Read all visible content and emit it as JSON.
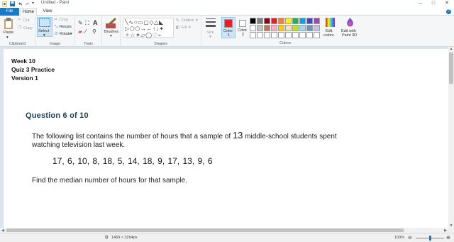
{
  "window": {
    "title": "Untitled - Paint",
    "controls": [
      "–",
      "□",
      "✕"
    ]
  },
  "tabs": {
    "file": "File",
    "home": "Home",
    "view": "View"
  },
  "ribbon": {
    "clipboard": {
      "paste": "Paste",
      "cut": "Cut",
      "copy": "Copy",
      "label": "Clipboard"
    },
    "image": {
      "select": "Select",
      "crop": "Crop",
      "resize": "Resize",
      "rotate": "Rotate",
      "label": "Image"
    },
    "tools": {
      "label": "Tools"
    },
    "brushes": {
      "label": "Brushes"
    },
    "shapes": {
      "outline": "Outline",
      "fill": "Fill",
      "label": "Shapes"
    },
    "size": {
      "label": "Size"
    },
    "color1": {
      "label": "Color",
      "num": "1",
      "value": "#ed1c24"
    },
    "color2": {
      "label": "Color",
      "num": "2",
      "value": "#ffffff"
    },
    "colors": {
      "label": "Colors",
      "palette_row1": [
        "#000000",
        "#7f7f7f",
        "#880015",
        "#ed1c24",
        "#ff7f27",
        "#fff200",
        "#22b14c",
        "#00a2e8",
        "#3f48cc",
        "#a349a4"
      ],
      "palette_row2": [
        "#ffffff",
        "#c3c3c3",
        "#b97a57",
        "#ffaec9",
        "#ffc90e",
        "#efe4b0",
        "#b5e61d",
        "#99d9ea",
        "#7092be",
        "#c8bfe7"
      ],
      "palette_row3": [
        "#ffffff",
        "#ffffff",
        "#ffffff",
        "#ffffff",
        "#ffffff",
        "#ffffff",
        "#ffffff",
        "#ffffff",
        "#ffffff",
        "#ffffff"
      ]
    },
    "edit_colors": {
      "line1": "Edit",
      "line2": "colors"
    },
    "paint3d": {
      "line1": "Edit with",
      "line2": "Paint 3D"
    }
  },
  "document": {
    "header": [
      "Week 10",
      "Quiz 3 Practice",
      "Version 1"
    ],
    "question_title": "Question 6 of 10",
    "prompt_before": "The following list contains the number of hours that a sample of ",
    "sample_size": "13",
    "prompt_after": " middle-school students spent",
    "prompt_line2": "watching television last week.",
    "data_values": "17, 6, 10, 8, 18, 5, 14, 18, 9, 17, 13, 9, 6",
    "instruction": "Find the median number of hours for that sample."
  },
  "status": {
    "dimensions": "1469 × 3264px",
    "zoom": "100%"
  }
}
